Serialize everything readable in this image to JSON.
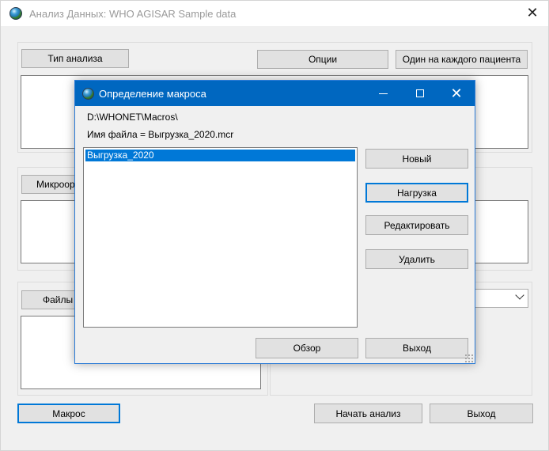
{
  "main": {
    "title": "Анализ Данных: WHO AGISAR Sample data",
    "close_glyph": "✕",
    "buttons": {
      "analysis_type": "Тип анализа",
      "options": "Опции",
      "one_per_patient": "Один на каждого пациента",
      "microorganisms": "Микроор",
      "files": "Файлы",
      "macro": "Макрос",
      "start_analysis": "Начать анализ",
      "exit": "Выход"
    }
  },
  "dialog": {
    "title": "Определение макроса",
    "path": "D:\\WHONET\\Macros\\",
    "filename": "Имя файла = Выгрузка_2020.mcr",
    "close_glyph": "✕",
    "list_items": [
      "Выгрузка_2020"
    ],
    "buttons": {
      "new": "Новый",
      "load": "Нагрузка",
      "edit": "Редактировать",
      "delete": "Удалить",
      "browse": "Обзор",
      "exit": "Выход"
    }
  },
  "colors": {
    "dialog_titlebar": "#0067c0",
    "selection": "#0078d7",
    "focus_border": "#0078d7"
  },
  "icons": {
    "app": "globe-icon",
    "dialog_app": "globe-icon",
    "main_close": "close-icon",
    "dialog_minimize": "minimize-icon",
    "dialog_maximize": "maximize-icon",
    "dialog_close": "close-icon",
    "combo_arrow": "chevron-down-icon"
  }
}
